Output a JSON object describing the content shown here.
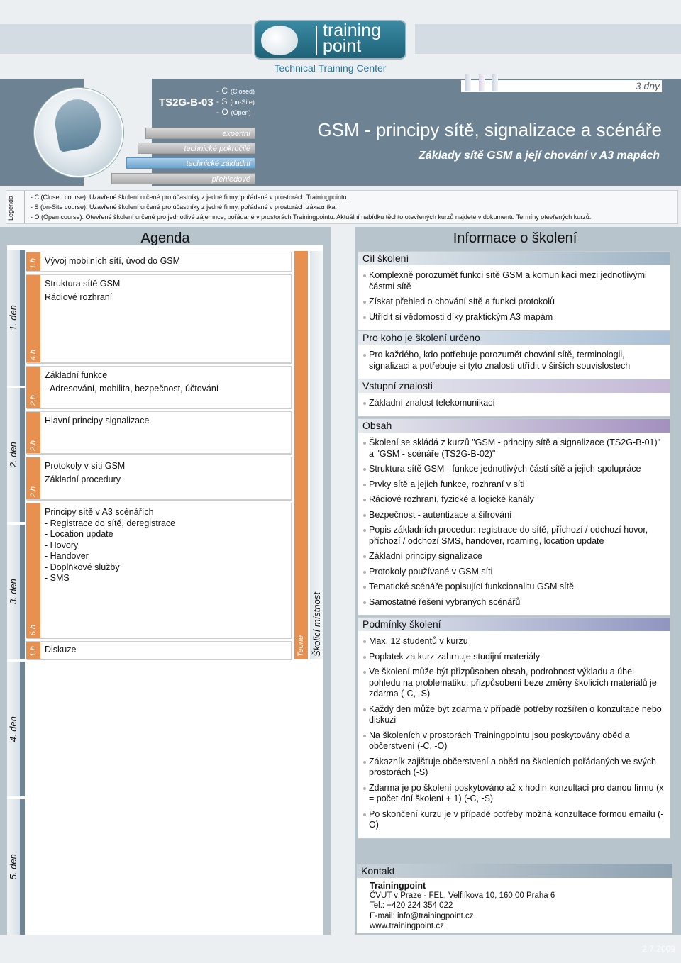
{
  "logo": {
    "line1": "training",
    "line2": "point",
    "tagline": "Technical Training Center"
  },
  "header": {
    "duration": "3 dny",
    "code": "TS2G-B-03",
    "course_types": [
      {
        "letter": "- C",
        "label": "(Closed)"
      },
      {
        "letter": "- S",
        "label": "(on-Site)"
      },
      {
        "letter": "- O",
        "label": "(Open)"
      }
    ],
    "levels": [
      {
        "label": "expertní",
        "active": false
      },
      {
        "label": "technické pokročilé",
        "active": false
      },
      {
        "label": "technické základní",
        "active": true
      },
      {
        "label": "přehledové",
        "active": false
      }
    ],
    "title": "GSM - principy sítě, signalizace a scénáře",
    "subtitle": "Základy sítě GSM a její chování v A3 mapách"
  },
  "legend": {
    "title": "Legenda",
    "lines": [
      "- C (Closed course): Uzavřené školení určené pro účastníky z jedné firmy, pořádané v prostorách Trainingpointu.",
      "- S (on-Site course): Uzavřené školení určené pro účastníky z jedné firmy, pořádané v prostorách zákazníka.",
      "- O (Open course):  Otevřené školení určené pro jednotlivé zájemnce, pořádané v prostorách Trainingpointu. Aktuální nabídku těchto otevřených kurzů najdete v dokumentu Termíny otevřených kurzů."
    ]
  },
  "agenda": {
    "title": "Agenda",
    "days": [
      "1. den",
      "2. den",
      "3. den",
      "4. den",
      "5. den"
    ],
    "items": [
      {
        "hours": "1.h",
        "lines": [
          "Vývoj mobilních sítí, úvod do GSM"
        ]
      },
      {
        "hours": "4.h",
        "lines": [
          "Struktura sítě GSM",
          "Rádiové rozhraní"
        ]
      },
      {
        "hours": "2.h",
        "lines": [
          "Základní funkce",
          "- Adresování, mobilita, bezpečnost, účtování"
        ]
      },
      {
        "hours": "2.h",
        "lines": [
          "Hlavní principy signalizace"
        ]
      },
      {
        "hours": "2.h",
        "lines": [
          "Protokoly v síti GSM",
          "Základní procedury"
        ]
      },
      {
        "hours": "6.h",
        "lines": [
          "Principy sítě v A3 scénářích",
          "- Registrace do sítě, deregistrace",
          "- Location update",
          "- Hovory",
          "- Handover",
          "- Doplňkové služby",
          "- SMS"
        ]
      },
      {
        "hours": "1.h",
        "lines": [
          "Diskuze"
        ]
      }
    ],
    "type_label": "Teorie",
    "location_label": "Školicí místnost"
  },
  "info": {
    "title": "Informace o školení",
    "sections": [
      {
        "title": "Cíl školení",
        "color": "#9fb4c4",
        "items": [
          "Komplexně porozumět funkci sítě GSM a komunikaci mezi jednotlivými částmi sítě",
          "Získat přehled o chování sítě a funkci protokolů",
          "Utřídit si vědomosti díky praktickým A3 mapám"
        ]
      },
      {
        "title": "Pro koho je školení určeno",
        "color": "#aac0d6",
        "items": [
          "Pro každého, kdo potřebuje porozumět chování sítě, terminologii, signalizaci a potřebuje si tyto znalosti utřídit v širších souvislostech"
        ]
      },
      {
        "title": "Vstupní znalosti",
        "color": "#c3b7d6",
        "items": [
          "Základní znalost telekomunikací"
        ]
      },
      {
        "title": "Obsah",
        "color": "#a48fc0",
        "items": [
          "Školení se skládá z kurzů \"GSM - principy sítě a signalizace (TS2G-B-01)\" a \"GSM - scénáře (TS2G-B-02)\"",
          "Struktura sítě GSM - funkce jednotlivých částí sítě a jejich spolupráce",
          "Prvky sítě a jejich funkce, rozhraní v síti",
          "Rádiové rozhraní, fyzické a logické kanály",
          "Bezpečnost - autentizace a šifrování",
          "Popis základních procedur: registrace do sítě, příchozí / odchozí hovor, příchozí / odchozí SMS, handover, roaming, location update",
          "Základní principy signalizace",
          "Protokoly používané v GSM síti",
          "Tematické scénáře popisující funkcionalitu GSM sítě",
          "Samostatné řešení vybraných scénářů"
        ]
      },
      {
        "title": "Podmínky školení",
        "color": "#8f95c0",
        "items": [
          "Max.  12 studentů v kurzu",
          "Poplatek za kurz zahrnuje studijní materiály",
          "Ve školení může být přizpůsoben obsah, podrobnost výkladu a úhel pohledu na problematiku; přizpůsobení beze změny školicích materiálů je zdarma (-C, -S)",
          "Každý den může být zdarma v případě potřeby rozšířen o konzultace nebo diskuzi",
          "Na školeních v prostorách Trainingpointu jsou poskytovány oběd a občerstvení (-C, -O)",
          "Zákazník zajišťuje občerstvení a oběd na školeních pořádaných ve svých prostorách (-S)",
          "Zdarma je po školení poskytováno až x hodin konzultací pro danou firmu (x = počet dní školení + 1) (-C, -S)",
          "Po skončení kurzu je v případě potřeby možná konzultace formou emailu (-O)"
        ]
      }
    ],
    "contact": {
      "title": "Kontakt",
      "org": "Trainingpoint",
      "address": "ČVUT v Praze - FEL, Velflíkova 10, 160 00  Praha 6",
      "phone": "Tel.: +420 224 354 022",
      "email": "E-mail: info@trainingpoint.cz",
      "web": "www.trainingpoint.cz"
    }
  },
  "footer": {
    "date": "2.7.2009"
  }
}
